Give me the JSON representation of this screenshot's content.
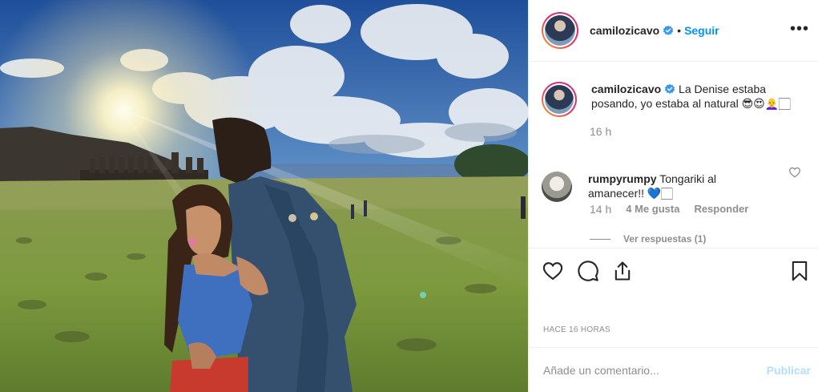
{
  "post": {
    "image_alt": "Pareja abrazada frente a los moáis de Tongariki al amanecer",
    "author": {
      "username": "camilozicavo",
      "verified": true,
      "follow_label": "Seguir",
      "separator": "•"
    },
    "more_label": "•••",
    "caption": {
      "username": "camilozicavo",
      "text": "La Denise estaba posando, yo estaba al natural 😎😍👩‍🦲🏻",
      "time": "16 h"
    },
    "comments": [
      {
        "username": "rumpyrumpy",
        "text": "Tongariki al amanecer!! 💙🏻",
        "time": "14 h",
        "likes": "4 Me gusta",
        "reply_label": "Responder",
        "view_replies": "Ver respuestas (1)"
      }
    ],
    "timestamp": "HACE 16 HORAS",
    "add_comment": {
      "placeholder": "Añade un comentario...",
      "publish_label": "Publicar"
    },
    "colors": {
      "accent": "#0095f6",
      "publish_disabled": "#b2dffc",
      "meta": "#8e8e8e",
      "text": "#262626",
      "verified": "#3897f0"
    },
    "icons": [
      "heart-icon",
      "comment-icon",
      "share-icon",
      "bookmark-icon",
      "verified-badge-icon",
      "more-options-icon"
    ]
  }
}
